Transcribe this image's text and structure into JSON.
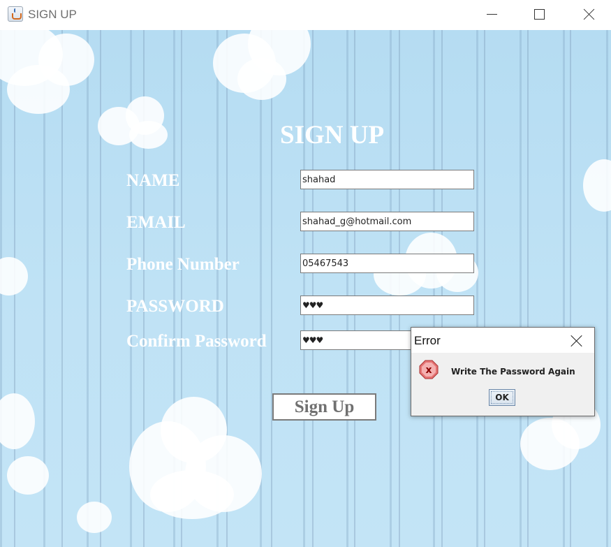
{
  "window": {
    "title": "SIGN UP",
    "icon": "java-cup-icon"
  },
  "form": {
    "heading": "SIGN UP",
    "fields": [
      {
        "label": "NAME",
        "value": "shahad"
      },
      {
        "label": "EMAIL",
        "value": "shahad_g@hotmail.com"
      },
      {
        "label": "Phone Number",
        "value": "05467543"
      },
      {
        "label": "PASSWORD",
        "value": "♥♥♥"
      },
      {
        "label": "Confirm Password",
        "value": "♥♥♥"
      }
    ],
    "submit_label": "Sign Up"
  },
  "dialog": {
    "title": "Error",
    "message": "Write The Password Again",
    "ok_label": "OK",
    "icon": "error-x-icon"
  },
  "colors": {
    "background": "#bfe2f5",
    "label_text": "#ffffff",
    "error_icon": "#e57373"
  }
}
